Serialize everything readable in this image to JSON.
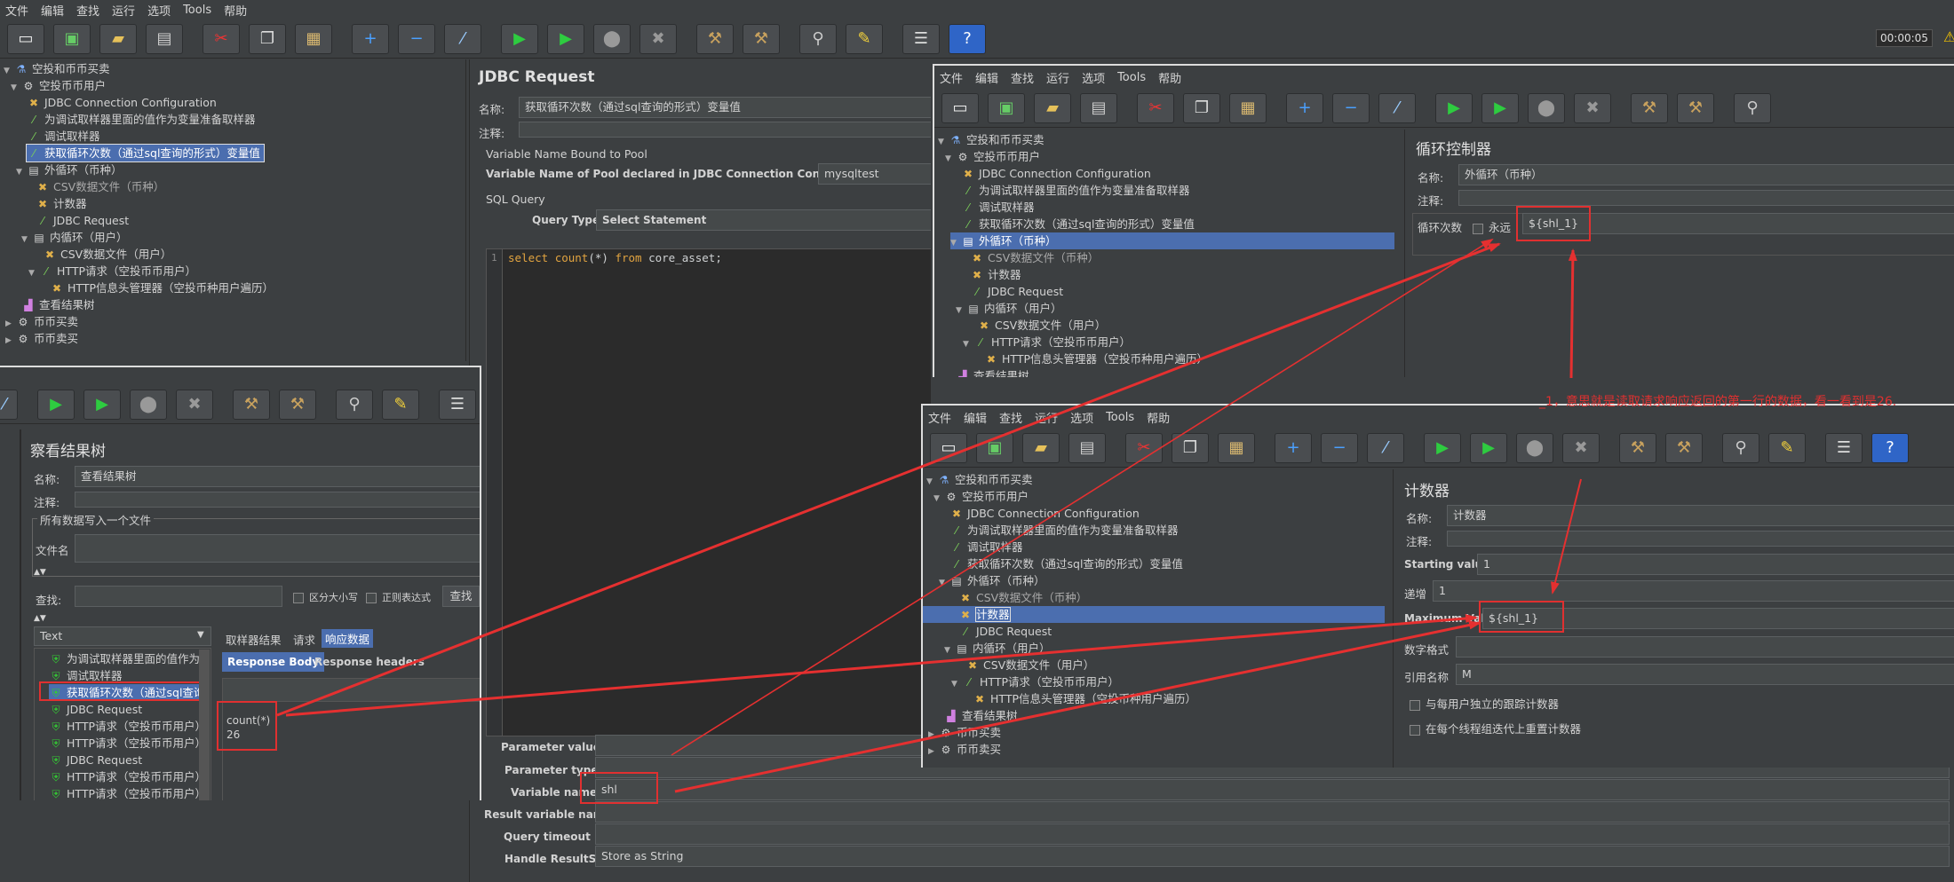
{
  "main": {
    "menu": [
      "文件",
      "编辑",
      "查找",
      "运行",
      "选项",
      "Tools",
      "帮助"
    ],
    "timer": "00:00:05",
    "tree": [
      {
        "label": "空投和币币买卖",
        "icon": "flask-icon"
      },
      {
        "label": "空投币币用户",
        "icon": "gear-icon"
      },
      {
        "label": "JDBC Connection Configuration",
        "icon": "wrench-icon"
      },
      {
        "label": "为调试取样器里面的值作为变量准备取样器",
        "icon": "dropper-icon"
      },
      {
        "label": "调试取样器",
        "icon": "dropper-icon"
      },
      {
        "label": "获取循环次数（通过sql查询的形式）变量值",
        "icon": "dropper-icon"
      },
      {
        "label": "外循环（币种）",
        "icon": "loop-icon"
      },
      {
        "label": "CSV数据文件（币种）",
        "icon": "wrench-icon"
      },
      {
        "label": "计数器",
        "icon": "wrench-icon"
      },
      {
        "label": "JDBC Request",
        "icon": "dropper-icon"
      },
      {
        "label": "内循环（用户）",
        "icon": "loop-icon"
      },
      {
        "label": "CSV数据文件（用户）",
        "icon": "wrench-icon"
      },
      {
        "label": "HTTP请求（空投币币用户）",
        "icon": "dropper-icon"
      },
      {
        "label": "HTTP信息头管理器（空投币种用户遍历）",
        "icon": "wrench-icon"
      },
      {
        "label": "查看结果树",
        "icon": "chart-icon"
      },
      {
        "label": "币币买卖",
        "icon": "gear-icon"
      },
      {
        "label": "币币卖买",
        "icon": "gear-icon"
      }
    ]
  },
  "jdbc": {
    "title": "JDBC Request",
    "name_label": "名称:",
    "name_value": "获取循环次数（通过sql查询的形式）变量值",
    "comment_label": "注释:",
    "pool_section": "Variable Name Bound to Pool",
    "pool_label": "Variable Name of Pool declared in JDBC Connection Configuration:",
    "pool_value": "mysqltest",
    "sql_section": "SQL Query",
    "query_type_label": "Query Type:",
    "query_type_value": "Select Statement",
    "line_no": "1",
    "sql_kw1": "select",
    "sql_kw2": "count",
    "sql_mid": "(*) ",
    "sql_kw3": "from",
    "sql_rest": " core_asset;",
    "param_values_label": "Parameter values:",
    "param_types_label": "Parameter types:",
    "var_names_label": "Variable names:",
    "var_names_value": "shl",
    "result_var_label": "Result variable name:",
    "timeout_label": "Query timeout (s):",
    "handle_label": "Handle ResultSet:",
    "handle_value": "Store as String"
  },
  "results": {
    "title": "察看结果树",
    "name_label": "名称:",
    "name_value": "查看结果树",
    "comment_label": "注释:",
    "file_section": "所有数据写入一个文件",
    "file_label": "文件名",
    "search_label": "查找:",
    "case_label": "区分大小写",
    "regex_label": "正则表达式",
    "search_button": "查找",
    "text_col": "Text",
    "tabs": [
      "取样器结果",
      "请求",
      "响应数据"
    ],
    "subtabs": [
      "Response Body",
      "Response headers"
    ],
    "items": [
      "为调试取样器里面的值作为",
      "调试取样器",
      "获取循环次数（通过sql查询",
      "JDBC Request",
      "HTTP请求（空投币币用户）",
      "HTTP请求（空投币币用户）",
      "JDBC Request",
      "HTTP请求（空投币币用户）",
      "HTTP请求（空投币币用户）"
    ],
    "body_line1": "count(*)",
    "body_line2": "26"
  },
  "loop_window": {
    "menu": [
      "文件",
      "编辑",
      "查找",
      "运行",
      "选项",
      "Tools",
      "帮助"
    ],
    "tree": [
      {
        "label": "空投和币币买卖",
        "icon": "flask-icon"
      },
      {
        "label": "空投币币用户",
        "icon": "gear-icon"
      },
      {
        "label": "JDBC Connection Configuration",
        "icon": "wrench-icon"
      },
      {
        "label": "为调试取样器里面的值作为变量准备取样器",
        "icon": "dropper-icon"
      },
      {
        "label": "调试取样器",
        "icon": "dropper-icon"
      },
      {
        "label": "获取循环次数（通过sql查询的形式）变量值",
        "icon": "dropper-icon"
      },
      {
        "label": "外循环（币种）",
        "icon": "loop-icon"
      },
      {
        "label": "CSV数据文件（币种）",
        "icon": "wrench-icon"
      },
      {
        "label": "计数器",
        "icon": "wrench-icon"
      },
      {
        "label": "JDBC Request",
        "icon": "dropper-icon"
      },
      {
        "label": "内循环（用户）",
        "icon": "loop-icon"
      },
      {
        "label": "CSV数据文件（用户）",
        "icon": "wrench-icon"
      },
      {
        "label": "HTTP请求（空投币币用户）",
        "icon": "dropper-icon"
      },
      {
        "label": "HTTP信息头管理器（空投币种用户遍历）",
        "icon": "wrench-icon"
      },
      {
        "label": "查看结果树",
        "icon": "chart-icon"
      }
    ],
    "title": "循环控制器",
    "name_label": "名称:",
    "name_value": "外循环（币种）",
    "comment_label": "注释:",
    "loop_label": "循环次数",
    "forever_label": "永远",
    "loop_value": "${shl_1}"
  },
  "counter_window": {
    "menu": [
      "文件",
      "编辑",
      "查找",
      "运行",
      "选项",
      "Tools",
      "帮助"
    ],
    "tree": [
      {
        "label": "空投和币币买卖",
        "icon": "flask-icon"
      },
      {
        "label": "空投币币用户",
        "icon": "gear-icon"
      },
      {
        "label": "JDBC Connection Configuration",
        "icon": "wrench-icon"
      },
      {
        "label": "为调试取样器里面的值作为变量准备取样器",
        "icon": "dropper-icon"
      },
      {
        "label": "调试取样器",
        "icon": "dropper-icon"
      },
      {
        "label": "获取循环次数（通过sql查询的形式）变量值",
        "icon": "dropper-icon"
      },
      {
        "label": "外循环（币种）",
        "icon": "loop-icon"
      },
      {
        "label": "CSV数据文件（币种）",
        "icon": "wrench-icon"
      },
      {
        "label": "计数器",
        "icon": "wrench-icon"
      },
      {
        "label": "JDBC Request",
        "icon": "dropper-icon"
      },
      {
        "label": "内循环（用户）",
        "icon": "loop-icon"
      },
      {
        "label": "CSV数据文件（用户）",
        "icon": "wrench-icon"
      },
      {
        "label": "HTTP请求（空投币币用户）",
        "icon": "dropper-icon"
      },
      {
        "label": "HTTP信息头管理器（空投币种用户遍历）",
        "icon": "wrench-icon"
      },
      {
        "label": "查看结果树",
        "icon": "chart-icon"
      },
      {
        "label": "币币买卖",
        "icon": "gear-icon"
      },
      {
        "label": "币币卖买",
        "icon": "gear-icon"
      }
    ],
    "title": "计数器",
    "name_label": "名称:",
    "name_value": "计数器",
    "comment_label": "注释:",
    "start_label": "Starting value",
    "start_value": "1",
    "incr_label": "递增",
    "incr_value": "1",
    "max_label": "Maximum Value",
    "max_value": "${shl_1}",
    "format_label": "数字格式",
    "ref_label": "引用名称",
    "ref_value": "M",
    "per_user_label": "与每用户独立的跟踪计数器",
    "reset_label": "在每个线程组迭代上重置计数器"
  },
  "annotation": "_1，意思就是读取请求响应返回的第一行的数据，看一看到是26."
}
